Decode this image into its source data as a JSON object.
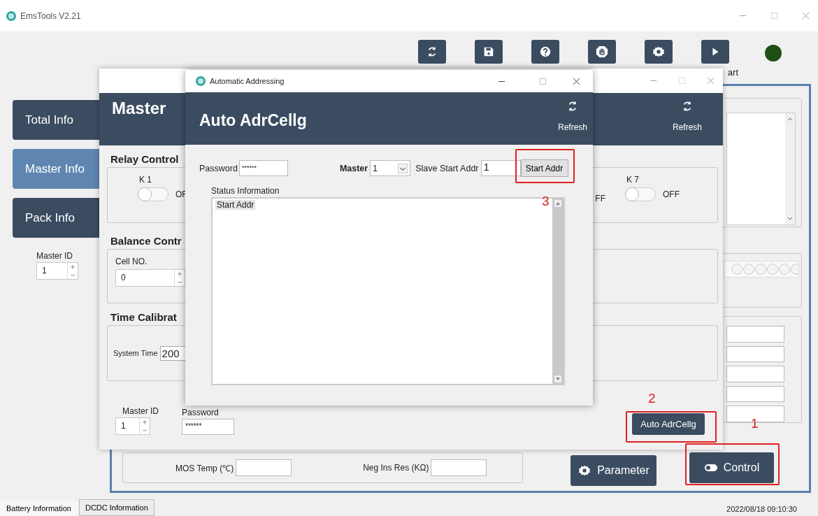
{
  "window": {
    "title": "EmsTools V2.21"
  },
  "toolbar": [
    {
      "kind": "refresh"
    },
    {
      "kind": "save"
    },
    {
      "kind": "help"
    },
    {
      "kind": "stop"
    },
    {
      "kind": "settings"
    },
    {
      "kind": "play",
      "label": "art"
    }
  ],
  "sidebar": [
    {
      "label": "Total Info",
      "selected": false
    },
    {
      "label": "Master Info",
      "selected": true
    },
    {
      "label": "Pack Info",
      "selected": false
    }
  ],
  "sidebar_master_id": {
    "label": "Master ID",
    "value": "1"
  },
  "main_panel": {
    "fields": [
      {
        "label": "MOS Temp (℃)"
      },
      {
        "label": "Neg Ins Res (KΩ)"
      }
    ],
    "buttons": [
      {
        "kind": "parameter",
        "label": "Parameter"
      },
      {
        "kind": "control",
        "label": "Control"
      }
    ]
  },
  "bottom_tabs": [
    {
      "label": "Battery Information",
      "selected": true
    },
    {
      "label": "DCDC Information",
      "selected": false
    }
  ],
  "status_time": "2022/08/18 09:10:30",
  "control_window": {
    "header": "Master",
    "refresh": "Refresh",
    "relay": {
      "title": "Relay Control",
      "left_switch": {
        "label": "K 1",
        "on": false,
        "state": "OF"
      },
      "partial_state": "FF",
      "right_switch": {
        "label": "K 7",
        "on": false,
        "state": "OFF"
      }
    },
    "balance": {
      "title": "Balance Contr",
      "label": "Cell NO.",
      "value": "0"
    },
    "time": {
      "title": "Time Calibrat",
      "label": "System Time",
      "value": "200"
    },
    "master_id": {
      "label": "Master ID",
      "value": "1"
    },
    "password": {
      "label": "Password",
      "value": "******"
    },
    "auto_button": "Auto AdrCellg"
  },
  "dialog": {
    "title": "Automatic Addressing",
    "header": "Auto AdrCellg",
    "refresh": "Refresh",
    "password": {
      "label": "Password",
      "value": "******"
    },
    "master": {
      "label": "Master",
      "value": "1"
    },
    "slave": {
      "label": "Slave Start Addr",
      "value": "1"
    },
    "start_button": "Start Addr",
    "status_label": "Status Information",
    "status_lines": [
      {
        "text": "Start Addr",
        "selected": true
      }
    ]
  },
  "annotations": [
    {
      "label": "1"
    },
    {
      "label": "2"
    },
    {
      "label": "3"
    }
  ]
}
